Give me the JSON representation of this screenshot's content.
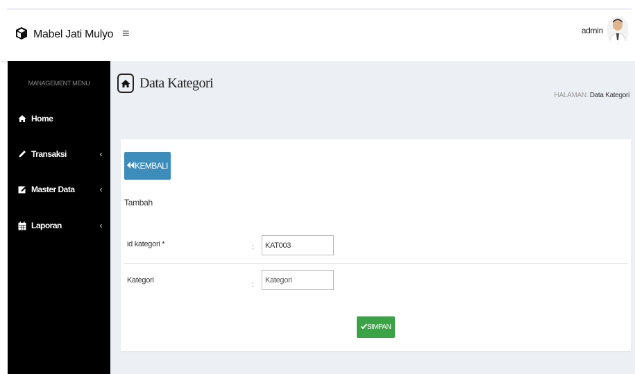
{
  "header": {
    "brand_name": "Mabel Jati Mulyo",
    "brand_icon": "cube-icon",
    "menu_toggle_icon": "hamburger-icon",
    "user_name": "admin"
  },
  "sidebar": {
    "menu_title": "MANAGEMENT MENU",
    "items": [
      {
        "label": "Home",
        "icon": "home-icon",
        "has_submenu": false
      },
      {
        "label": "Transaksi",
        "icon": "pencil-icon",
        "has_submenu": true
      },
      {
        "label": "Master Data",
        "icon": "edit-icon",
        "has_submenu": true
      },
      {
        "label": "Laporan",
        "icon": "calendar-icon",
        "has_submenu": true
      }
    ],
    "chevron": "‹"
  },
  "page": {
    "title": "Data Kategori",
    "breadcrumb_label": "HALAMAN:",
    "breadcrumb_current": "Data Kategori"
  },
  "form": {
    "back_label": "KEMBALI",
    "subtitle": "Tambah",
    "fields": [
      {
        "label": "id kategori *",
        "value": "KAT003",
        "placeholder": ""
      },
      {
        "label": "Kategori",
        "value": "",
        "placeholder": "Kategori"
      }
    ],
    "separator": ":",
    "save_label": "SIMPAN"
  },
  "colors": {
    "sidebar_bg": "#000000",
    "primary": "#3c8dbc",
    "success": "#3aa346",
    "content_bg": "#ecf0f5"
  }
}
